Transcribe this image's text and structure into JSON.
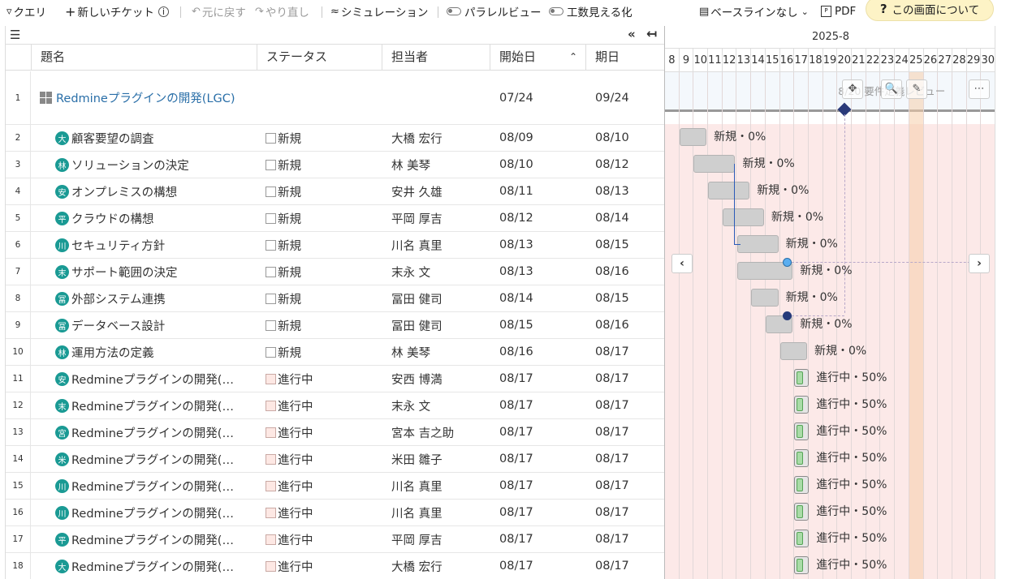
{
  "toolbar": {
    "query": "クエリ",
    "new_ticket": "新しいチケット",
    "undo": "元に戻す",
    "redo": "やり直し",
    "simulation": "シミュレーション",
    "parallel_view": "パラレルビュー",
    "effort_view": "工数見える化",
    "baseline": "ベースラインなし",
    "pdf": "PDF",
    "help": "この画面について"
  },
  "grid": {
    "columns": {
      "title": "題名",
      "status": "ステータス",
      "assignee": "担当者",
      "start": "開始日",
      "due": "期日"
    },
    "rows": [
      {
        "no": "1",
        "avatar": "",
        "title": "Redmineプラグインの開発(LGC)",
        "status": "",
        "assignee": "",
        "start": "07/24",
        "due": "09/24",
        "project": true
      },
      {
        "no": "2",
        "avatar": "大",
        "title": "顧客要望の調査",
        "status": "新規",
        "assignee": "大橋 宏行",
        "start": "08/09",
        "due": "08/10"
      },
      {
        "no": "3",
        "avatar": "林",
        "title": "ソリューションの決定",
        "status": "新規",
        "assignee": "林 美琴",
        "start": "08/10",
        "due": "08/12"
      },
      {
        "no": "4",
        "avatar": "安",
        "title": "オンプレミスの構想",
        "status": "新規",
        "assignee": "安井 久雄",
        "start": "08/11",
        "due": "08/13"
      },
      {
        "no": "5",
        "avatar": "平",
        "title": "クラウドの構想",
        "status": "新規",
        "assignee": "平岡 厚吉",
        "start": "08/12",
        "due": "08/14"
      },
      {
        "no": "6",
        "avatar": "川",
        "title": "セキュリティ方針",
        "status": "新規",
        "assignee": "川名 真里",
        "start": "08/13",
        "due": "08/15"
      },
      {
        "no": "7",
        "avatar": "末",
        "title": "サポート範囲の決定",
        "status": "新規",
        "assignee": "末永 文",
        "start": "08/13",
        "due": "08/16"
      },
      {
        "no": "8",
        "avatar": "冨",
        "title": "外部システム連携",
        "status": "新規",
        "assignee": "冨田 健司",
        "start": "08/14",
        "due": "08/15"
      },
      {
        "no": "9",
        "avatar": "冨",
        "title": "データベース設計",
        "status": "新規",
        "assignee": "冨田 健司",
        "start": "08/15",
        "due": "08/16"
      },
      {
        "no": "10",
        "avatar": "林",
        "title": "運用方法の定義",
        "status": "新規",
        "assignee": "林 美琴",
        "start": "08/16",
        "due": "08/17"
      },
      {
        "no": "11",
        "avatar": "安",
        "title": "Redmineプラグインの開発(…",
        "status": "進行中",
        "assignee": "安西 博満",
        "start": "08/17",
        "due": "08/17"
      },
      {
        "no": "12",
        "avatar": "末",
        "title": "Redmineプラグインの開発(…",
        "status": "進行中",
        "assignee": "末永 文",
        "start": "08/17",
        "due": "08/17"
      },
      {
        "no": "13",
        "avatar": "宮",
        "title": "Redmineプラグインの開発(…",
        "status": "進行中",
        "assignee": "宮本 吉之助",
        "start": "08/17",
        "due": "08/17"
      },
      {
        "no": "14",
        "avatar": "米",
        "title": "Redmineプラグインの開発(…",
        "status": "進行中",
        "assignee": "米田 雛子",
        "start": "08/17",
        "due": "08/17"
      },
      {
        "no": "15",
        "avatar": "川",
        "title": "Redmineプラグインの開発(…",
        "status": "進行中",
        "assignee": "川名 真里",
        "start": "08/17",
        "due": "08/17"
      },
      {
        "no": "16",
        "avatar": "川",
        "title": "Redmineプラグインの開発(…",
        "status": "進行中",
        "assignee": "川名 真里",
        "start": "08/17",
        "due": "08/17"
      },
      {
        "no": "17",
        "avatar": "平",
        "title": "Redmineプラグインの開発(…",
        "status": "進行中",
        "assignee": "平岡 厚吉",
        "start": "08/17",
        "due": "08/17"
      },
      {
        "no": "18",
        "avatar": "大",
        "title": "Redmineプラグインの開発(…",
        "status": "進行中",
        "assignee": "大橋 宏行",
        "start": "08/17",
        "due": "08/17"
      }
    ]
  },
  "gantt": {
    "month": "2025-8",
    "days": [
      "8",
      "9",
      "10",
      "11",
      "12",
      "13",
      "14",
      "15",
      "16",
      "17",
      "18",
      "19",
      "20",
      "21",
      "22",
      "23",
      "24",
      "25",
      "26",
      "27",
      "28",
      "29",
      "30"
    ],
    "today_day": "25",
    "milestone_label": "8/20 要件定義レビュー",
    "bar_labels": [
      "新規・0%",
      "新規・0%",
      "新規・0%",
      "新規・0%",
      "新規・0%",
      "新規・0%",
      "新規・0%",
      "新規・0%",
      "新規・0%",
      "進行中・50%",
      "進行中・50%",
      "進行中・50%",
      "進行中・50%",
      "進行中・50%",
      "進行中・50%",
      "進行中・50%",
      "進行中・50%"
    ],
    "progress": [
      0,
      0,
      0,
      0,
      0,
      0,
      0,
      0,
      0,
      50,
      50,
      50,
      50,
      50,
      50,
      50,
      50
    ]
  }
}
